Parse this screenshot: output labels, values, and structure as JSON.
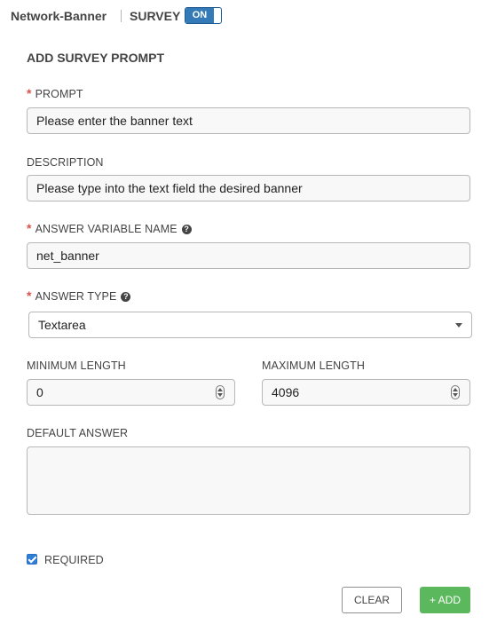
{
  "header": {
    "title": "Network-Banner",
    "survey_label": "SURVEY",
    "toggle_label": "ON"
  },
  "form": {
    "title": "ADD SURVEY PROMPT",
    "required_marker": "*",
    "prompt": {
      "label": "PROMPT",
      "value": "Please enter the banner text"
    },
    "description": {
      "label": "DESCRIPTION",
      "value": "Please type into the text field the desired banner"
    },
    "variable": {
      "label": "ANSWER VARIABLE NAME",
      "value": "net_banner"
    },
    "answer_type": {
      "label": "ANSWER TYPE",
      "selected": "Textarea"
    },
    "min_length": {
      "label": "MINIMUM LENGTH",
      "value": "0"
    },
    "max_length": {
      "label": "MAXIMUM LENGTH",
      "value": "4096"
    },
    "default_answer": {
      "label": "DEFAULT ANSWER",
      "value": ""
    },
    "required": {
      "label": "REQUIRED",
      "checked": true
    }
  },
  "buttons": {
    "clear": "CLEAR",
    "add": "+ ADD"
  },
  "icons": {
    "help": "question-circle-icon",
    "dropdown": "chevron-down-icon",
    "stepper": "number-stepper-icon",
    "checkbox": "checkbox-checked-icon"
  },
  "colors": {
    "required": "#d9534f",
    "toggle_on": "#337ab7",
    "add_button": "#5cb85c",
    "checkbox": "#2f7ed8"
  }
}
